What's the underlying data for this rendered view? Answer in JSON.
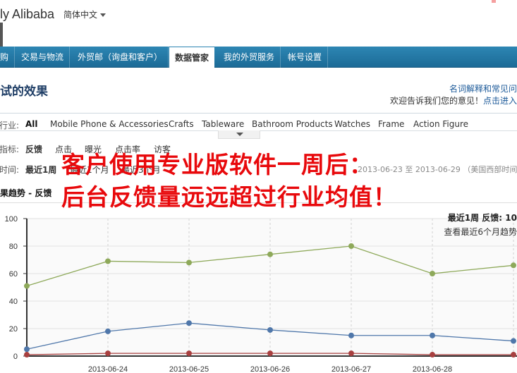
{
  "header": {
    "logo_text": "ly Alibaba",
    "language": "简体中文"
  },
  "nav": {
    "items": [
      {
        "label": "购",
        "active": false
      },
      {
        "label": "交易与物流",
        "active": false
      },
      {
        "label": "外贸邮（询盘和客户）",
        "active": false
      },
      {
        "label": "数据管家",
        "active": true
      },
      {
        "label": "我的外贸服务",
        "active": false
      },
      {
        "label": "帐号设置",
        "active": false
      }
    ]
  },
  "page": {
    "title": "试的效果",
    "glossary_link": "名词解释和常见问",
    "feedback_text": "欢迎告诉我们您的意见！",
    "feedback_link": "点击进入"
  },
  "filters": {
    "industry_label": "行业:",
    "categories": [
      "All",
      "Mobile Phone & Accessories",
      "Crafts",
      "Tableware",
      "Bathroom Products",
      "Watches",
      "Frame",
      "Action Figure"
    ],
    "metric_label": "指标:",
    "metrics": [
      "反馈",
      "点击",
      "曝光",
      "点击率",
      "访客"
    ],
    "time_label": "时间:",
    "periods": [
      "最近1周",
      "最近1个月",
      "最近3个月"
    ],
    "date_range": "2013-06-23 至 2013-06-29 （美国西部时间"
  },
  "trend": {
    "title": "果趋势 - 反馈"
  },
  "overlay": {
    "line1": "客户使用专业版软件一周后：",
    "line2": "后台反馈量远远超过行业均值！"
  },
  "chart_side": {
    "summary": "最近1周 反馈: 10",
    "link": "查看最近6个月趋势"
  },
  "colors": {
    "nav_bg": "#1f74a3",
    "overlay_red": "#e8090c",
    "series_green": "#8ea95a",
    "series_blue": "#4f77aa",
    "series_red": "#a84040"
  },
  "chart_data": {
    "type": "line",
    "x": [
      "2013-06-23",
      "2013-06-24",
      "2013-06-25",
      "2013-06-26",
      "2013-06-27",
      "2013-06-28",
      "2013-06-29"
    ],
    "x_tick_labels": [
      "2013-06-24",
      "2013-06-25",
      "2013-06-26",
      "2013-06-27",
      "2013-06-28"
    ],
    "ylim": [
      0,
      100
    ],
    "yticks": [
      0,
      20,
      40,
      60,
      80,
      100
    ],
    "grid": true,
    "series": [
      {
        "color": "#8ea95a",
        "values": [
          51,
          69,
          68,
          74,
          80,
          60,
          66
        ]
      },
      {
        "color": "#4f77aa",
        "values": [
          5,
          18,
          24,
          19,
          15,
          15,
          11
        ]
      },
      {
        "color": "#a84040",
        "values": [
          1,
          2,
          2,
          2,
          2,
          1,
          1
        ]
      }
    ]
  }
}
